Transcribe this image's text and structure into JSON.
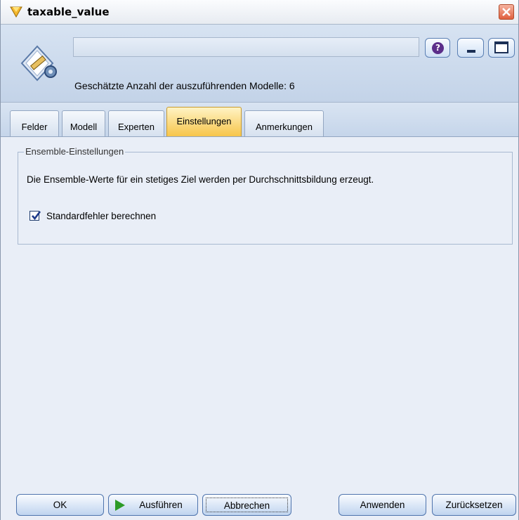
{
  "window": {
    "title": "taxable_value",
    "icons": {
      "title": "diamond-node-icon",
      "close": "close-icon",
      "node": "ruler-gear-node-icon"
    }
  },
  "header": {
    "name_value": "",
    "model_count_text": "Geschätzte Anzahl der auszuführenden Modelle: 6",
    "help_label": "?"
  },
  "tabs": [
    {
      "label": "Felder",
      "active": false
    },
    {
      "label": "Modell",
      "active": false
    },
    {
      "label": "Experten",
      "active": false
    },
    {
      "label": "Einstellungen",
      "active": true
    },
    {
      "label": "Anmerkungen",
      "active": false
    }
  ],
  "ensemble": {
    "group_title": "Ensemble-Einstellungen",
    "description": "Die Ensemble-Werte für ein stetiges Ziel werden per Durchschnittsbildung erzeugt.",
    "checkbox_label": "Standardfehler berechnen",
    "checkbox_checked": true
  },
  "footer": {
    "ok": "OK",
    "run": "Ausführen",
    "cancel": "Abbrechen",
    "apply": "Anwenden",
    "reset": "Zurücksetzen"
  },
  "colors": {
    "accent_tab": "#f7c54a",
    "header_bg": "#c3d3e8",
    "close_red": "#e0603e"
  }
}
